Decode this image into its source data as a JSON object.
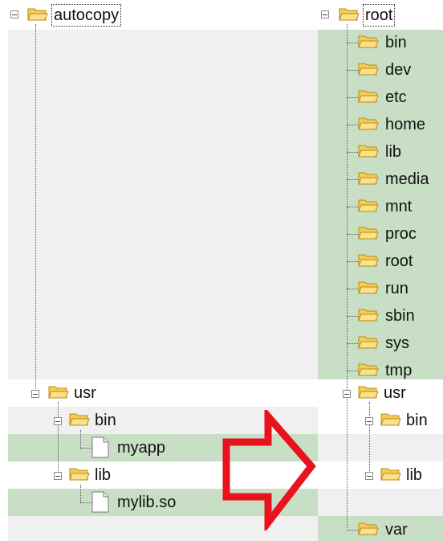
{
  "left_tree": {
    "root": "autocopy",
    "usr": "usr",
    "bin": "bin",
    "myapp": "myapp",
    "lib": "lib",
    "mylib": "mylib.so"
  },
  "right_tree": {
    "root": "root",
    "top_dirs": [
      "bin",
      "dev",
      "etc",
      "home",
      "lib",
      "media",
      "mnt",
      "proc",
      "root",
      "run",
      "sbin",
      "sys",
      "tmp"
    ],
    "usr": "usr",
    "usr_bin": "bin",
    "usr_lib": "lib",
    "var": "var"
  },
  "colors": {
    "panel_grey": "#f0f0f0",
    "highlight_green": "#c8dfc6",
    "arrow_red": "#e8131c",
    "folder_yellow": "#f7d463"
  },
  "icons": {
    "folder": "folder-icon",
    "file": "file-icon",
    "collapse": "collapse-icon",
    "arrow": "copy-direction-arrow"
  }
}
